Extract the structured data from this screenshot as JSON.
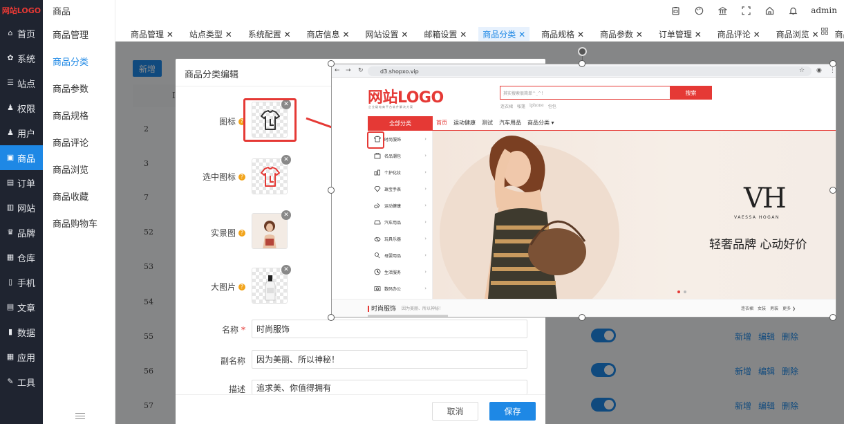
{
  "app": {
    "logo_text": "网站LOGO"
  },
  "sidebar": {
    "items": [
      {
        "label": "首页",
        "icon": "home-icon",
        "glyph": "⌂"
      },
      {
        "label": "系统",
        "icon": "gear-icon",
        "glyph": "✿"
      },
      {
        "label": "站点",
        "icon": "sliders-icon",
        "glyph": "☰"
      },
      {
        "label": "权限",
        "icon": "user-lock-icon",
        "glyph": "♟"
      },
      {
        "label": "用户",
        "icon": "user-icon",
        "glyph": "♟"
      },
      {
        "label": "商品",
        "icon": "goods-icon",
        "glyph": "▣",
        "active": true
      },
      {
        "label": "订单",
        "icon": "order-icon",
        "glyph": "▤"
      },
      {
        "label": "网站",
        "icon": "website-icon",
        "glyph": "▥"
      },
      {
        "label": "品牌",
        "icon": "brand-icon",
        "glyph": "♛"
      },
      {
        "label": "仓库",
        "icon": "warehouse-icon",
        "glyph": "▦"
      },
      {
        "label": "手机",
        "icon": "mobile-icon",
        "glyph": "▯"
      },
      {
        "label": "文章",
        "icon": "article-icon",
        "glyph": "▤"
      },
      {
        "label": "数据",
        "icon": "chart-icon",
        "glyph": "▮"
      },
      {
        "label": "应用",
        "icon": "apps-icon",
        "glyph": "▦"
      },
      {
        "label": "工具",
        "icon": "wrench-icon",
        "glyph": "✎"
      }
    ]
  },
  "submenu": {
    "title": "商品",
    "items": [
      {
        "label": "商品管理"
      },
      {
        "label": "商品分类",
        "active": true
      },
      {
        "label": "商品参数"
      },
      {
        "label": "商品规格"
      },
      {
        "label": "商品评论"
      },
      {
        "label": "商品浏览"
      },
      {
        "label": "商品收藏"
      },
      {
        "label": "商品购物车"
      }
    ]
  },
  "header": {
    "user": "admin"
  },
  "tabs": [
    {
      "label": "商品管理 ✕"
    },
    {
      "label": "站点类型 ✕"
    },
    {
      "label": "系统配置 ✕"
    },
    {
      "label": "商店信息 ✕"
    },
    {
      "label": "网站设置 ✕"
    },
    {
      "label": "邮箱设置 ✕"
    },
    {
      "label": "商品分类 ✕",
      "active": true
    },
    {
      "label": "商品规格 ✕"
    },
    {
      "label": "商品参数 ✕"
    },
    {
      "label": "订单管理 ✕"
    },
    {
      "label": "商品评论 ✕"
    },
    {
      "label": "商品浏览 ✕"
    },
    {
      "label": "商品收藏 ✕"
    }
  ],
  "list": {
    "add_label": "新增",
    "col_head": "I",
    "row_ids": [
      "2",
      "3",
      "7",
      "52",
      "53",
      "54",
      "55",
      "56",
      "57"
    ],
    "actions": {
      "add": "新增",
      "edit": "编辑",
      "delete": "删除"
    }
  },
  "modal": {
    "title": "商品分类编辑",
    "labels": {
      "icon": "图标",
      "selected_icon": "选中图标",
      "scene_image": "实景图",
      "big_image": "大图片",
      "name": "名称",
      "subname": "副名称",
      "description": "描述"
    },
    "values": {
      "name": "时尚服饰",
      "subname": "因为美丽、所以神秘！",
      "description": "追求美、你值得拥有"
    },
    "cancel_label": "取消",
    "save_label": "保存"
  },
  "preview": {
    "url": "d3.shopxo.vip",
    "logo": "网站LOGO",
    "logo_sub": "企业级电商平台软件解决方案",
    "search_placeholder": "其实搜索很简单^_^！",
    "search_button": "搜索",
    "hot_words": [
      "连衣裙",
      "帐篷",
      "iphone",
      "包包"
    ],
    "all_categories": "全部分类",
    "nav": [
      "首页",
      "运动健康",
      "测试",
      "汽车用品",
      "商品分类 ▾"
    ],
    "categories": [
      {
        "label": "时尚服饰",
        "icon": "tshirt-icon"
      },
      {
        "label": "名品潮包",
        "icon": "bag-icon"
      },
      {
        "label": "个护化妆",
        "icon": "cosmetics-icon"
      },
      {
        "label": "珠宝手表",
        "icon": "diamond-icon"
      },
      {
        "label": "运动健康",
        "icon": "sport-icon"
      },
      {
        "label": "汽车用品",
        "icon": "car-icon"
      },
      {
        "label": "玩具乐器",
        "icon": "toy-icon"
      },
      {
        "label": "母婴用品",
        "icon": "baby-icon"
      },
      {
        "label": "生活服务",
        "icon": "service-icon"
      },
      {
        "label": "数码办公",
        "icon": "camera-icon"
      }
    ],
    "brand_logo": "VH",
    "brand_name": "VAESSA HOGAN",
    "slogan": "轻奢品牌 心动好价",
    "floor_title": "时尚服饰",
    "floor_sub": "因为美丽、所以神秘！",
    "floor_tags": [
      "连衣裙",
      "女装",
      "男装",
      "更多 ❯"
    ]
  },
  "colors": {
    "accent": "#1e88e5",
    "sidebar_bg": "#1f2430",
    "brand_red": "#e53935"
  }
}
